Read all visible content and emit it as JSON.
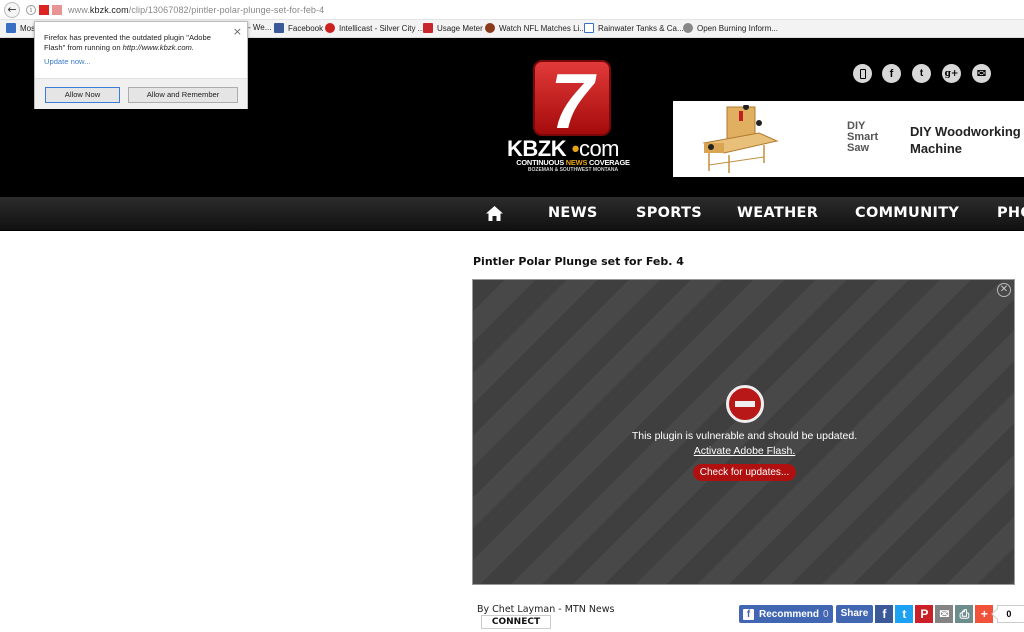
{
  "browser": {
    "url_domain": "www.kbzk.com",
    "url_prefix": "www.",
    "url_host": "kbzk.com",
    "url_path": "/clip/13067082/pintler-polar-plunge-set-for-feb-4",
    "bookmarks": [
      {
        "label": "Mos",
        "icon": "bookmark-page-icon",
        "color": "#3a6fc4"
      },
      {
        "label": "- We...",
        "icon": "none",
        "color": "#fff"
      },
      {
        "label": "Facebook",
        "icon": "facebook-icon",
        "color": "#3b5998"
      },
      {
        "label": "Intellicast - Silver City ...",
        "icon": "intellicast-icon",
        "color": "#cc1f1f"
      },
      {
        "label": "Usage Meter",
        "icon": "usage-meter-icon",
        "color": "#c8262d"
      },
      {
        "label": "Watch NFL Matches Li...",
        "icon": "football-icon",
        "color": "#8a3a1a"
      },
      {
        "label": "Rainwater Tanks & Ca...",
        "icon": "page-icon",
        "color": "#3a6fc4"
      },
      {
        "label": "Open Burning Inform...",
        "icon": "globe-icon",
        "color": "#888"
      }
    ]
  },
  "popup": {
    "message_1": "Firefox has prevented the outdated plugin \"Adobe Flash\" from running on ",
    "message_url": "http://www.kbzk.com.",
    "update_link": "Update now...",
    "allow_now": "Allow Now",
    "allow_remember": "Allow and Remember",
    "close": "×"
  },
  "header": {
    "logo_number": "7",
    "logo_name": "KBZK",
    "logo_dot": "•",
    "logo_com": "com",
    "tagline_1": "CONTINUOUS ",
    "tagline_news": "NEWS",
    "tagline_2": " COVERAGE",
    "tagline_sub": "BOZEMAN & SOUTHWEST MONTANA",
    "social": [
      {
        "name": "mobile-icon",
        "glyph": "▯"
      },
      {
        "name": "facebook-icon",
        "glyph": "f"
      },
      {
        "name": "twitter-icon",
        "glyph": "t"
      },
      {
        "name": "google-plus-icon",
        "glyph": "g+"
      },
      {
        "name": "email-icon",
        "glyph": "✉"
      }
    ],
    "ad": {
      "brand": "DIY Smart Saw",
      "brand_lines": [
        "DIY",
        "Smart",
        "Saw"
      ],
      "title": "DIY Woodworking Machine"
    }
  },
  "nav": {
    "items": [
      "NEWS",
      "SPORTS",
      "WEATHER",
      "COMMUNITY",
      "PHO"
    ]
  },
  "article": {
    "title": "Pintler Polar Plunge set for Feb. 4",
    "plugin_message": "This plugin is vulnerable and should be updated.",
    "activate_link": "Activate Adobe Flash.",
    "update_button": "Check for updates...",
    "close_glyph": "✕",
    "byline": "By Chet Layman - MTN News",
    "connect": "CONNECT"
  },
  "share": {
    "recommend_label": "Recommend",
    "recommend_count": "0",
    "share_label": "Share",
    "buttons": [
      {
        "name": "facebook-share-icon",
        "glyph": "f",
        "color": "#3b5998"
      },
      {
        "name": "twitter-share-icon",
        "glyph": "t",
        "color": "#1da1f2"
      },
      {
        "name": "pinterest-share-icon",
        "glyph": "P",
        "color": "#cb2027"
      },
      {
        "name": "email-share-icon",
        "glyph": "✉",
        "color": "#848484"
      },
      {
        "name": "print-share-icon",
        "glyph": "⎙",
        "color": "#6d8c8c"
      },
      {
        "name": "more-share-icon",
        "glyph": "+",
        "color": "#f0533a"
      }
    ],
    "total_count": "0"
  }
}
